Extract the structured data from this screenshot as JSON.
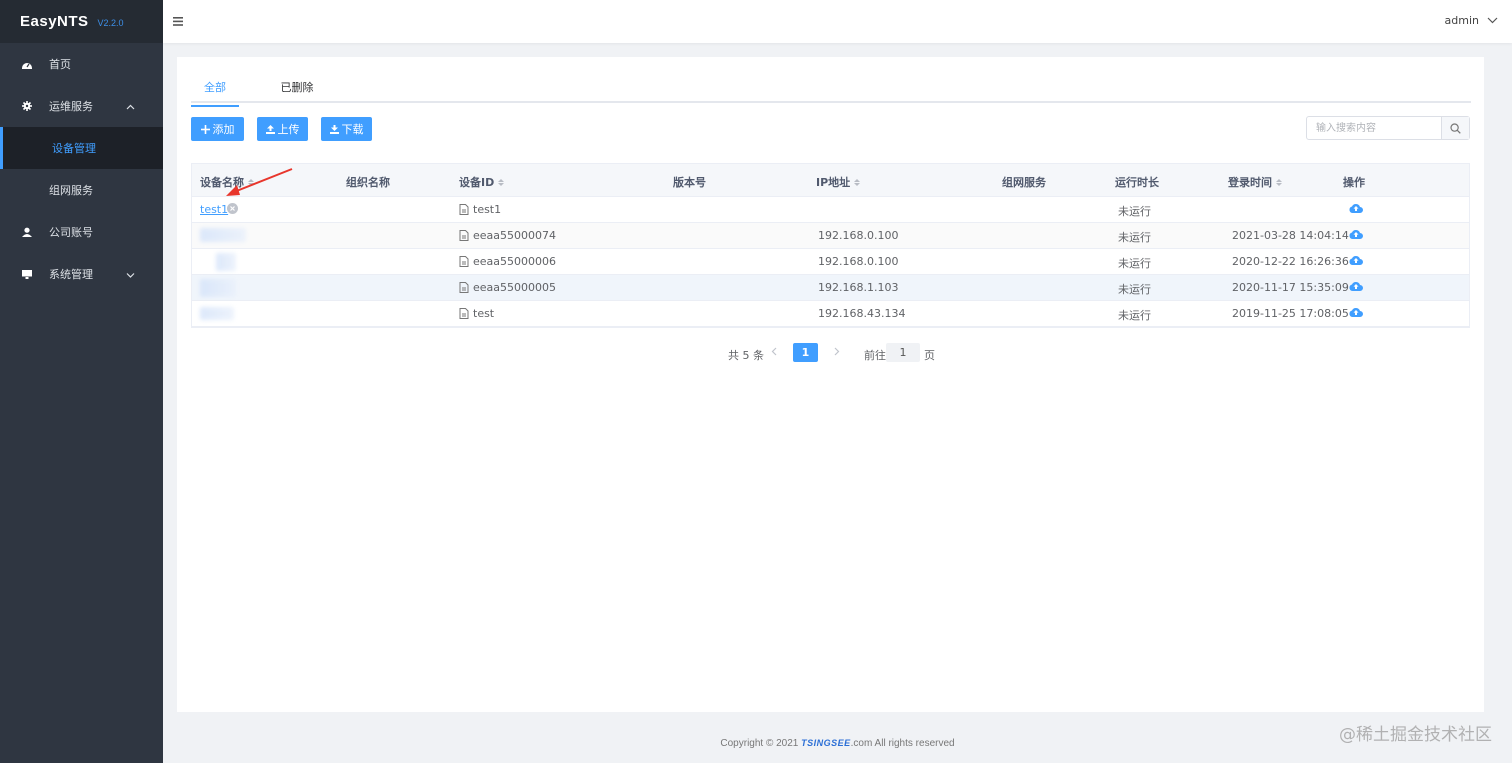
{
  "brand": {
    "name": "EasyNTS",
    "version": "V2.2.0"
  },
  "sidebar": {
    "items": [
      {
        "label": "首页",
        "icon": "dashboard-icon"
      },
      {
        "label": "运维服务",
        "icon": "gear-icon",
        "expanded": true,
        "children": [
          {
            "label": "设备管理",
            "active": true
          },
          {
            "label": "组网服务"
          }
        ]
      },
      {
        "label": "公司账号",
        "icon": "user-icon"
      },
      {
        "label": "系统管理",
        "icon": "monitor-icon",
        "expanded": false
      }
    ]
  },
  "topbar": {
    "user": "admin"
  },
  "tabs": [
    {
      "label": "全部",
      "active": true
    },
    {
      "label": "已删除"
    }
  ],
  "toolbar": {
    "add_label": "添加",
    "upload_label": "上传",
    "download_label": "下载"
  },
  "search": {
    "placeholder": "输入搜索内容"
  },
  "table": {
    "headers": {
      "name": "设备名称",
      "org": "组织名称",
      "device_id": "设备ID",
      "version": "版本号",
      "ip": "IP地址",
      "network": "组网服务",
      "runtime": "运行时长",
      "login_time": "登录时间",
      "action": "操作"
    },
    "rows": [
      {
        "name": "test1",
        "device_id": "test1",
        "ip": "",
        "runtime": "未运行",
        "login_time": ""
      },
      {
        "name": "",
        "device_id": "eeaa55000074",
        "ip": "192.168.0.100",
        "runtime": "未运行",
        "login_time": "2021-03-28 14:04:14"
      },
      {
        "name": "",
        "device_id": "eeaa55000006",
        "ip": "192.168.0.100",
        "runtime": "未运行",
        "login_time": "2020-12-22 16:26:36"
      },
      {
        "name": "",
        "device_id": "eeaa55000005",
        "ip": "192.168.1.103",
        "runtime": "未运行",
        "login_time": "2020-11-17 15:35:09"
      },
      {
        "name": "",
        "device_id": "test",
        "ip": "192.168.43.134",
        "runtime": "未运行",
        "login_time": "2019-11-25 17:08:05"
      }
    ]
  },
  "pagination": {
    "total": "共 5 条",
    "current": "1",
    "goto_prefix": "前往",
    "goto_value": "1",
    "goto_suffix": "页"
  },
  "footer": {
    "prefix": "Copyright © 2021 ",
    "brand": "TSINGSEE",
    "suffix": ".com All rights reserved"
  },
  "watermark": "@稀土掘金技术社区",
  "colors": {
    "primary": "#409eff",
    "sidebar": "#2f3641",
    "annotation_arrow": "#e8362c"
  }
}
